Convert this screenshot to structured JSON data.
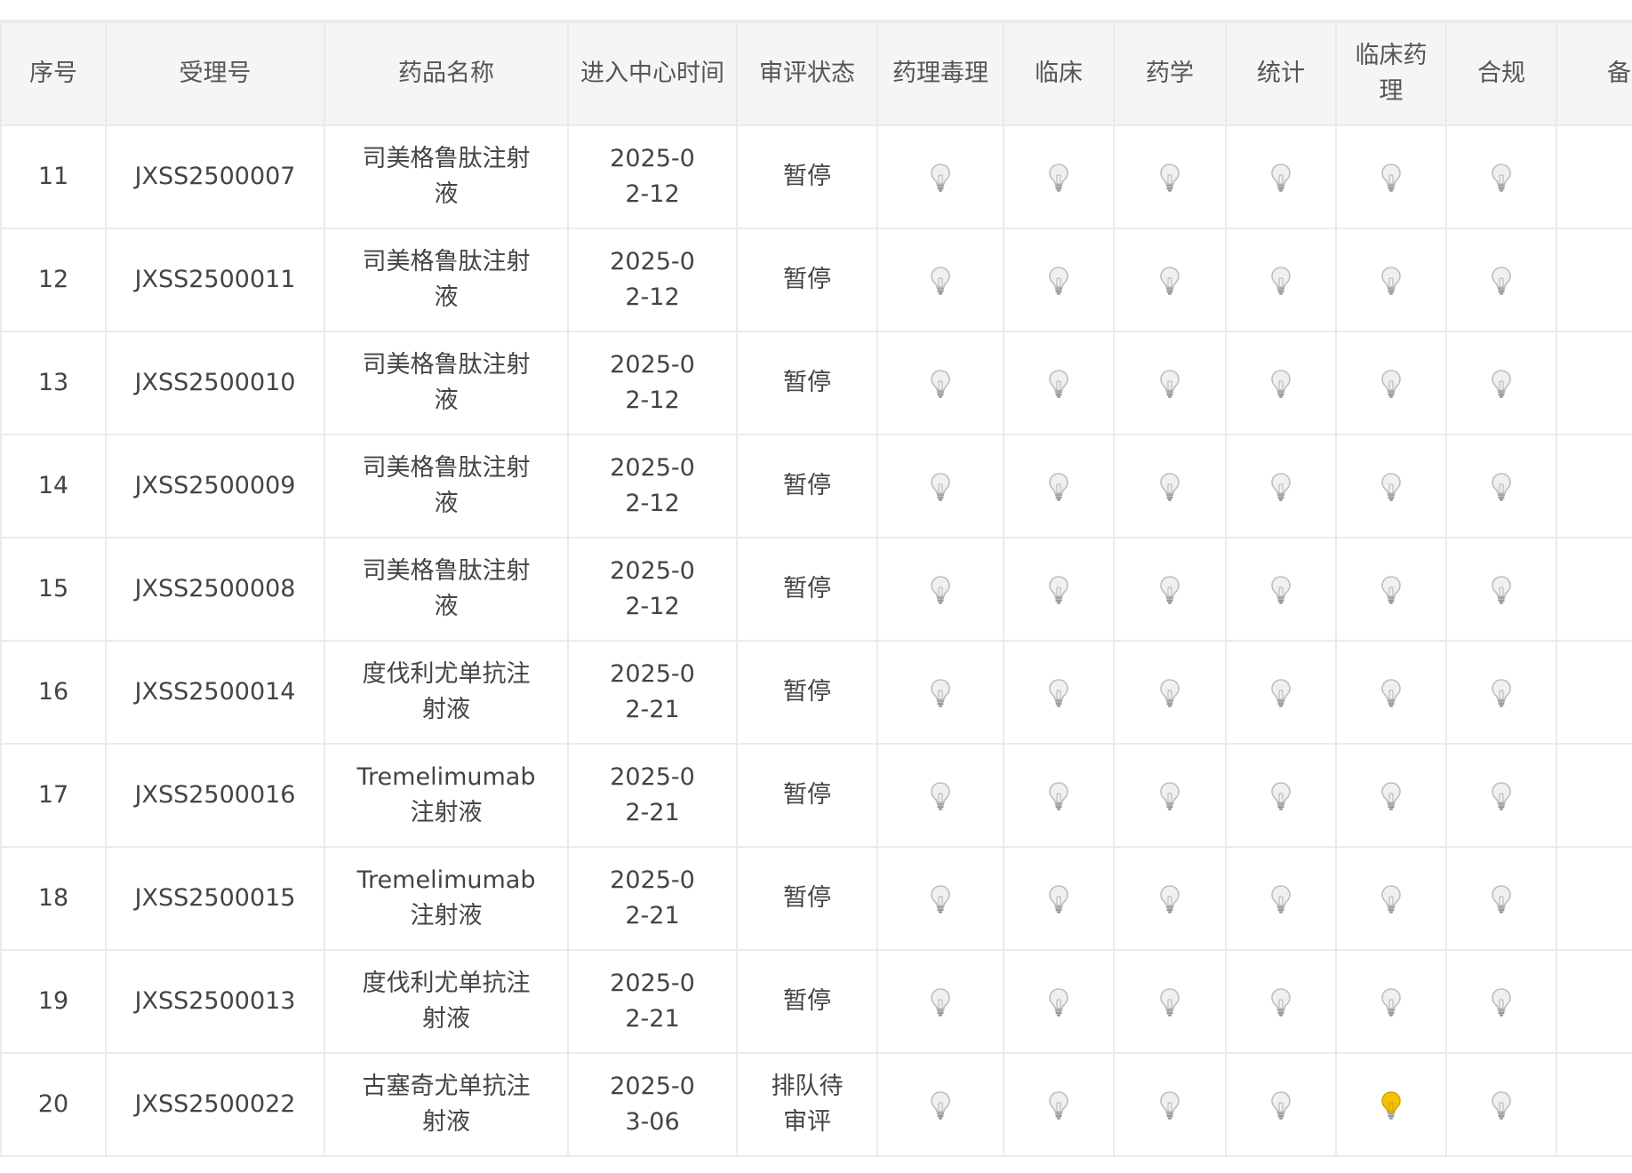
{
  "colors": {
    "header_bg": "#f5f5f5",
    "border": "#ebebeb",
    "bulb_off": "#d4d4d4",
    "bulb_on": "#f2c200"
  },
  "table": {
    "headers": {
      "index": "序号",
      "accept_no": "受理号",
      "drug_name": "药品名称",
      "enter_time": "进入中心时间",
      "status": "审评状态",
      "pharm_tox": "药理毒理",
      "clinical": "临床",
      "pharmacy": "药学",
      "statistics": "统计",
      "clin_pharm": "临床药理",
      "compliance": "合规",
      "remarks": "备注"
    },
    "rows": [
      {
        "index": "11",
        "accept_no": "JXSS2500007",
        "drug_name": "司美格鲁肽注射液",
        "enter_time": "2025-02-12",
        "status": "暂停",
        "bulbs": [
          "off",
          "off",
          "off",
          "off",
          "off",
          "off"
        ]
      },
      {
        "index": "12",
        "accept_no": "JXSS2500011",
        "drug_name": "司美格鲁肽注射液",
        "enter_time": "2025-02-12",
        "status": "暂停",
        "bulbs": [
          "off",
          "off",
          "off",
          "off",
          "off",
          "off"
        ]
      },
      {
        "index": "13",
        "accept_no": "JXSS2500010",
        "drug_name": "司美格鲁肽注射液",
        "enter_time": "2025-02-12",
        "status": "暂停",
        "bulbs": [
          "off",
          "off",
          "off",
          "off",
          "off",
          "off"
        ]
      },
      {
        "index": "14",
        "accept_no": "JXSS2500009",
        "drug_name": "司美格鲁肽注射液",
        "enter_time": "2025-02-12",
        "status": "暂停",
        "bulbs": [
          "off",
          "off",
          "off",
          "off",
          "off",
          "off"
        ]
      },
      {
        "index": "15",
        "accept_no": "JXSS2500008",
        "drug_name": "司美格鲁肽注射液",
        "enter_time": "2025-02-12",
        "status": "暂停",
        "bulbs": [
          "off",
          "off",
          "off",
          "off",
          "off",
          "off"
        ]
      },
      {
        "index": "16",
        "accept_no": "JXSS2500014",
        "drug_name": "度伐利尤单抗注射液",
        "enter_time": "2025-02-21",
        "status": "暂停",
        "bulbs": [
          "off",
          "off",
          "off",
          "off",
          "off",
          "off"
        ]
      },
      {
        "index": "17",
        "accept_no": "JXSS2500016",
        "drug_name": "Tremelimumab 注射液",
        "enter_time": "2025-02-21",
        "status": "暂停",
        "bulbs": [
          "off",
          "off",
          "off",
          "off",
          "off",
          "off"
        ]
      },
      {
        "index": "18",
        "accept_no": "JXSS2500015",
        "drug_name": "Tremelimumab 注射液",
        "enter_time": "2025-02-21",
        "status": "暂停",
        "bulbs": [
          "off",
          "off",
          "off",
          "off",
          "off",
          "off"
        ]
      },
      {
        "index": "19",
        "accept_no": "JXSS2500013",
        "drug_name": "度伐利尤单抗注射液",
        "enter_time": "2025-02-21",
        "status": "暂停",
        "bulbs": [
          "off",
          "off",
          "off",
          "off",
          "off",
          "off"
        ]
      },
      {
        "index": "20",
        "accept_no": "JXSS2500022",
        "drug_name": "古塞奇尤单抗注射液",
        "enter_time": "2025-03-06",
        "status": "排队待审评",
        "bulbs": [
          "off",
          "off",
          "off",
          "off",
          "on",
          "off"
        ]
      }
    ]
  }
}
